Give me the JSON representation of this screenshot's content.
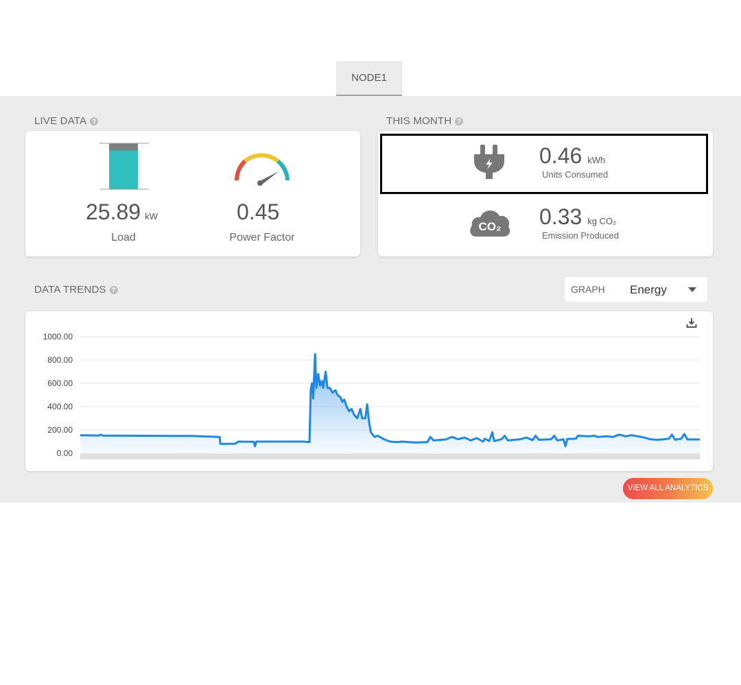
{
  "tabs": [
    {
      "label": "NODE1",
      "active": true
    }
  ],
  "live_data": {
    "title": "LIVE DATA",
    "load": {
      "value": "25.89",
      "unit": "kW",
      "label": "Load",
      "fill_fraction": 0.85
    },
    "power_factor": {
      "value": "0.45",
      "label": "Power Factor"
    }
  },
  "this_month": {
    "title": "THIS MONTH",
    "units": {
      "value": "0.46",
      "unit": "kWh",
      "label": "Units Consumed",
      "icon": "plug-icon"
    },
    "emission": {
      "value": "0.33",
      "unit": "kg CO₂",
      "label": "Emission Produced",
      "icon": "co2-cloud-icon",
      "icon_text": "CO₂"
    }
  },
  "data_trends": {
    "title": "DATA TRENDS",
    "graph_label": "GRAPH",
    "graph_selected": "Energy"
  },
  "chart_data": {
    "type": "area",
    "yticks": [
      "1000.00",
      "800.00",
      "600.00",
      "400.00",
      "200.00",
      "0.00"
    ],
    "ylim": [
      0,
      1000
    ],
    "grid": true,
    "series": [
      {
        "color": "#1e88e5",
        "points": [
          [
            0,
            155
          ],
          [
            3,
            152
          ],
          [
            3.3,
            160
          ],
          [
            3.6,
            152
          ],
          [
            10,
            150
          ],
          [
            18,
            148
          ],
          [
            22.5,
            140
          ],
          [
            22.6,
            80
          ],
          [
            25,
            82
          ],
          [
            25.5,
            100
          ],
          [
            28,
            98
          ],
          [
            28.2,
            60
          ],
          [
            28.4,
            100
          ],
          [
            36,
            100
          ],
          [
            37,
            95
          ],
          [
            37.2,
            550
          ],
          [
            37.4,
            600
          ],
          [
            37.6,
            470
          ],
          [
            37.9,
            850
          ],
          [
            38.1,
            560
          ],
          [
            38.4,
            680
          ],
          [
            38.7,
            580
          ],
          [
            39,
            620
          ],
          [
            39.2,
            560
          ],
          [
            39.6,
            700
          ],
          [
            39.9,
            560
          ],
          [
            40.3,
            560
          ],
          [
            40.7,
            520
          ],
          [
            41.2,
            540
          ],
          [
            41.5,
            500
          ],
          [
            42,
            480
          ],
          [
            42.3,
            440
          ],
          [
            42.6,
            460
          ],
          [
            43,
            400
          ],
          [
            43.4,
            360
          ],
          [
            43.8,
            380
          ],
          [
            44.2,
            330
          ],
          [
            44.7,
            300
          ],
          [
            45.2,
            380
          ],
          [
            45.5,
            300
          ],
          [
            46,
            300
          ],
          [
            46.3,
            420
          ],
          [
            46.6,
            270
          ],
          [
            46.9,
            180
          ],
          [
            47.5,
            140
          ],
          [
            48,
            150
          ],
          [
            49,
            120
          ],
          [
            50,
            100
          ],
          [
            51,
            95
          ],
          [
            52,
            100
          ],
          [
            54,
            92
          ],
          [
            56,
            95
          ],
          [
            56.5,
            140
          ],
          [
            57,
            110
          ],
          [
            59,
            118
          ],
          [
            60,
            140
          ],
          [
            61,
            120
          ],
          [
            62,
            135
          ],
          [
            63,
            110
          ],
          [
            64,
            130
          ],
          [
            65,
            100
          ],
          [
            65.3,
            125
          ],
          [
            66,
            105
          ],
          [
            66.5,
            180
          ],
          [
            66.8,
            105
          ],
          [
            68,
            120
          ],
          [
            68.5,
            150
          ],
          [
            69,
            110
          ],
          [
            71,
            120
          ],
          [
            72,
            135
          ],
          [
            73,
            112
          ],
          [
            73.5,
            150
          ],
          [
            74,
            115
          ],
          [
            76,
            120
          ],
          [
            76.5,
            150
          ],
          [
            77,
            110
          ],
          [
            78,
            120
          ],
          [
            78.3,
            60
          ],
          [
            78.6,
            122
          ],
          [
            80,
            125
          ],
          [
            80.3,
            150
          ],
          [
            82,
            145
          ],
          [
            83,
            150
          ],
          [
            83.5,
            140
          ],
          [
            85,
            145
          ],
          [
            86,
            140
          ],
          [
            87,
            160
          ],
          [
            88,
            145
          ],
          [
            89,
            155
          ],
          [
            90,
            145
          ],
          [
            91,
            135
          ],
          [
            92,
            120
          ],
          [
            93,
            115
          ],
          [
            94,
            118
          ],
          [
            95,
            125
          ],
          [
            95.5,
            160
          ],
          [
            96,
            115
          ],
          [
            97,
            125
          ],
          [
            97.5,
            165
          ],
          [
            98,
            118
          ],
          [
            100,
            118
          ]
        ]
      }
    ]
  },
  "view_all_button": "VIEW ALL ANALYTICS"
}
